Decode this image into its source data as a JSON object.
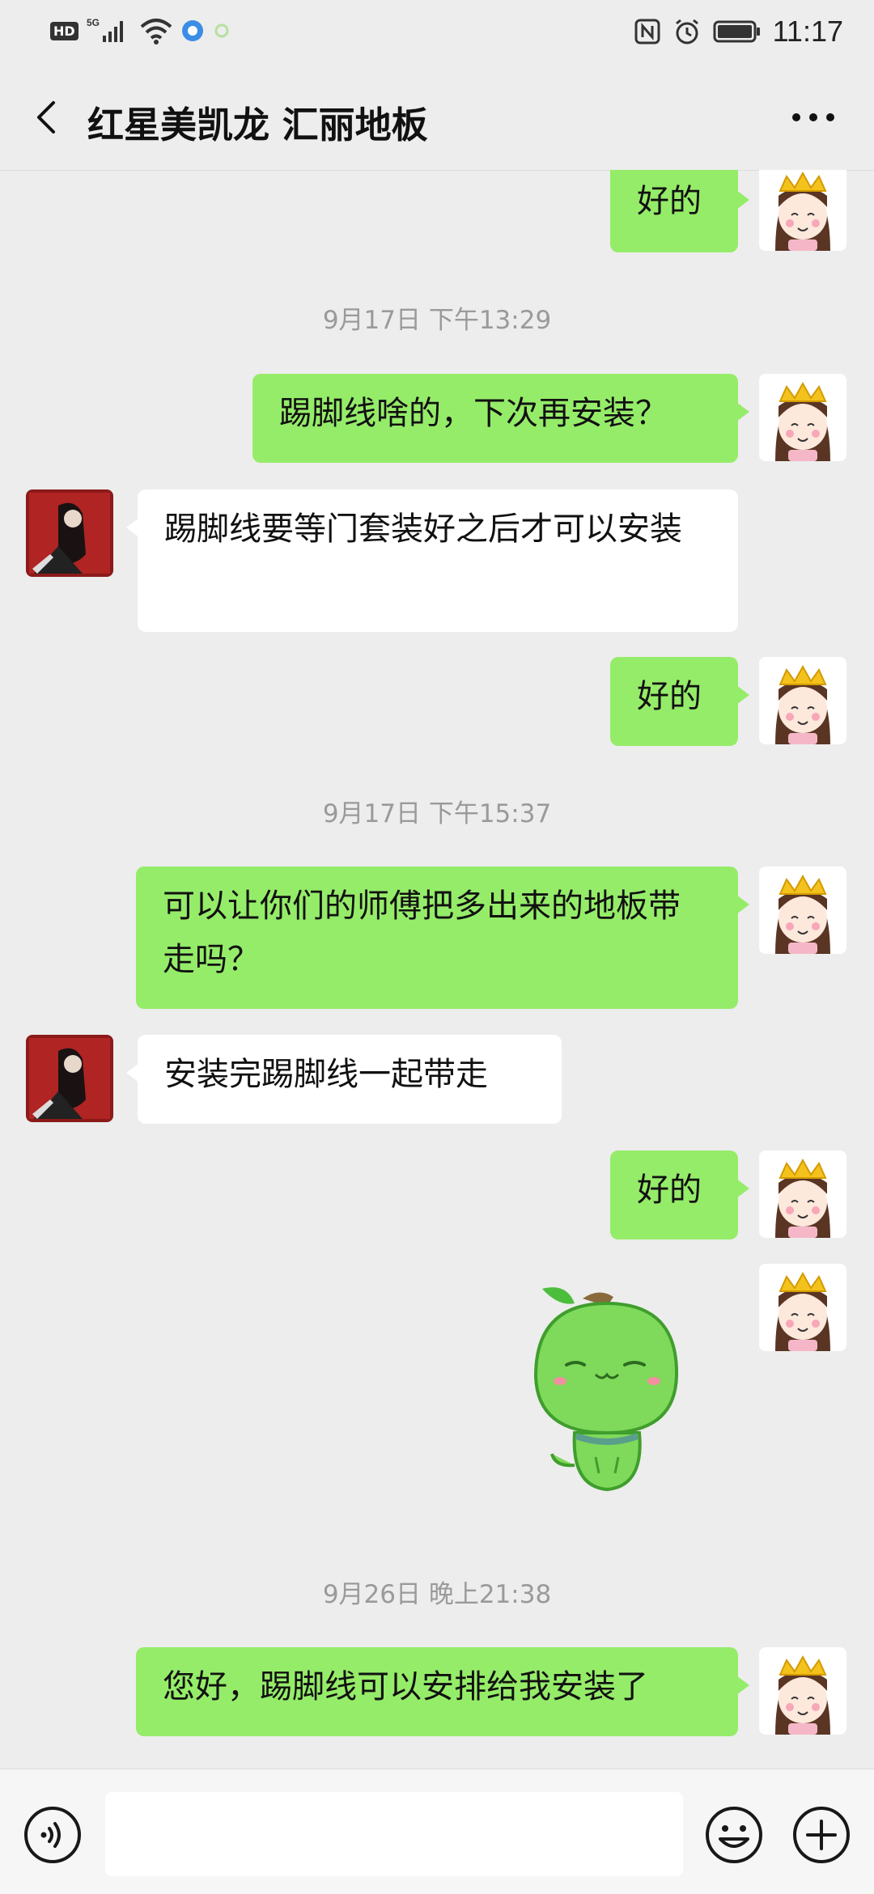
{
  "status_bar": {
    "hd": "HD",
    "network": "5G",
    "time": "11:17"
  },
  "header": {
    "title": "红星美凯龙 汇丽地板"
  },
  "messages": [
    {
      "kind": "me",
      "text": "好的"
    },
    {
      "kind": "time",
      "text": "9月17日 下午13:29"
    },
    {
      "kind": "me",
      "text": "踢脚线啥的，下次再安装？"
    },
    {
      "kind": "other",
      "text": "踢脚线要等门套装好之后才可以安装"
    },
    {
      "kind": "me",
      "text": "好的"
    },
    {
      "kind": "time",
      "text": "9月17日 下午15:37"
    },
    {
      "kind": "me",
      "text": "可以让你们的师傅把多出来的地板带走吗？"
    },
    {
      "kind": "other",
      "text": "安装完踢脚线一起带走"
    },
    {
      "kind": "me",
      "text": "好的"
    },
    {
      "kind": "me_sticker",
      "sticker": "green-bean-sticker"
    },
    {
      "kind": "time",
      "text": "9月26日 晚上21:38"
    },
    {
      "kind": "me",
      "text": "您好，踢脚线可以安排给我安装了"
    }
  ],
  "input_bar": {
    "value": "",
    "voice_icon": "voice-icon",
    "emoji_icon": "emoji-icon",
    "plus_icon": "plus-icon"
  },
  "colors": {
    "my_bubble": "#95ec69",
    "other_bubble": "#ffffff",
    "background": "#ededed"
  }
}
